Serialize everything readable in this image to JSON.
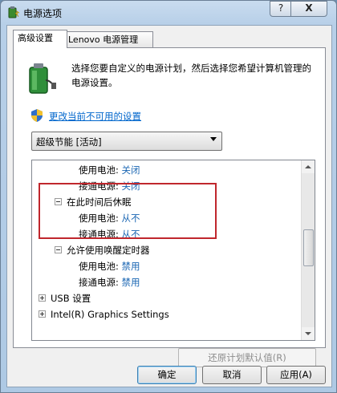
{
  "window": {
    "title": "电源选项",
    "help_label": "?",
    "close_label": "X"
  },
  "tabs": [
    {
      "label": "高级设置",
      "active": true
    },
    {
      "label": "Lenovo 电源管理",
      "active": false
    }
  ],
  "description": "选择您要自定义的电源计划，然后选择您希望计算机管理的电源设置。",
  "change_link": "更改当前不可用的设置",
  "plan_select": {
    "value": "超级节能 [活动]"
  },
  "tree": [
    {
      "label": "使用电池:",
      "value": "关闭",
      "indent": 2
    },
    {
      "label": "接通电源:",
      "value": "关闭",
      "indent": 2
    },
    {
      "label": "在此时间后休眠",
      "value": "",
      "indent": 1,
      "expander": "minus"
    },
    {
      "label": "使用电池:",
      "value": "从不",
      "indent": 2
    },
    {
      "label": "接通电源:",
      "value": "从不",
      "indent": 2
    },
    {
      "label": "允许使用唤醒定时器",
      "value": "",
      "indent": 1,
      "expander": "minus"
    },
    {
      "label": "使用电池:",
      "value": "禁用",
      "indent": 2
    },
    {
      "label": "接通电源:",
      "value": "禁用",
      "indent": 2
    },
    {
      "label": "USB 设置",
      "value": "",
      "indent": 0,
      "expander": "plus"
    },
    {
      "label": "Intel(R) Graphics Settings",
      "value": "",
      "indent": 0,
      "expander": "plus"
    }
  ],
  "buttons": {
    "restore": "还原计划默认值(R)",
    "ok": "确定",
    "cancel": "取消",
    "apply": "应用(A)"
  },
  "colors": {
    "link": "#0066cc",
    "value": "#1a66b3",
    "highlight": "#c0272d"
  }
}
